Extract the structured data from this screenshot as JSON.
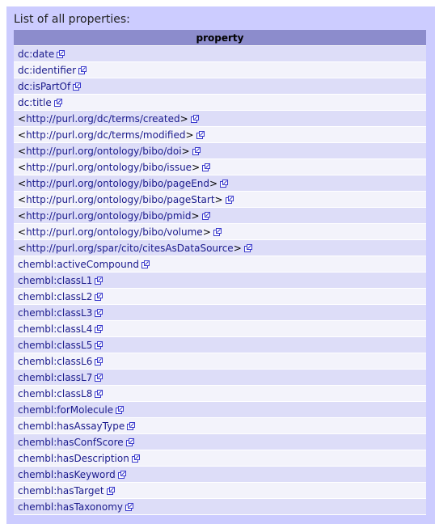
{
  "title": "List of all properties:",
  "table": {
    "header": "property",
    "rows": [
      {
        "label": "dc:date",
        "angle": false
      },
      {
        "label": "dc:identifier",
        "angle": false
      },
      {
        "label": "dc:isPartOf",
        "angle": false
      },
      {
        "label": "dc:title",
        "angle": false
      },
      {
        "label": "http://purl.org/dc/terms/created",
        "angle": true
      },
      {
        "label": "http://purl.org/dc/terms/modified",
        "angle": true
      },
      {
        "label": "http://purl.org/ontology/bibo/doi",
        "angle": true
      },
      {
        "label": "http://purl.org/ontology/bibo/issue",
        "angle": true
      },
      {
        "label": "http://purl.org/ontology/bibo/pageEnd",
        "angle": true
      },
      {
        "label": "http://purl.org/ontology/bibo/pageStart",
        "angle": true
      },
      {
        "label": "http://purl.org/ontology/bibo/pmid",
        "angle": true
      },
      {
        "label": "http://purl.org/ontology/bibo/volume",
        "angle": true
      },
      {
        "label": "http://purl.org/spar/cito/citesAsDataSource",
        "angle": true
      },
      {
        "label": "chembl:activeCompound",
        "angle": false
      },
      {
        "label": "chembl:classL1",
        "angle": false
      },
      {
        "label": "chembl:classL2",
        "angle": false
      },
      {
        "label": "chembl:classL3",
        "angle": false
      },
      {
        "label": "chembl:classL4",
        "angle": false
      },
      {
        "label": "chembl:classL5",
        "angle": false
      },
      {
        "label": "chembl:classL6",
        "angle": false
      },
      {
        "label": "chembl:classL7",
        "angle": false
      },
      {
        "label": "chembl:classL8",
        "angle": false
      },
      {
        "label": "chembl:forMolecule",
        "angle": false
      },
      {
        "label": "chembl:hasAssayType",
        "angle": false
      },
      {
        "label": "chembl:hasConfScore",
        "angle": false
      },
      {
        "label": "chembl:hasDescription",
        "angle": false
      },
      {
        "label": "chembl:hasKeyword",
        "angle": false
      },
      {
        "label": "chembl:hasTarget",
        "angle": false
      },
      {
        "label": "chembl:hasTaxonomy",
        "angle": false
      }
    ]
  },
  "icons": {
    "external_link": "external-link-icon"
  },
  "colors": {
    "panel_bg": "#ccccff",
    "header_bg": "#8c8ccc",
    "row_odd": "#ddddf8",
    "row_even": "#f3f3fb",
    "link": "#1a1a8c"
  }
}
